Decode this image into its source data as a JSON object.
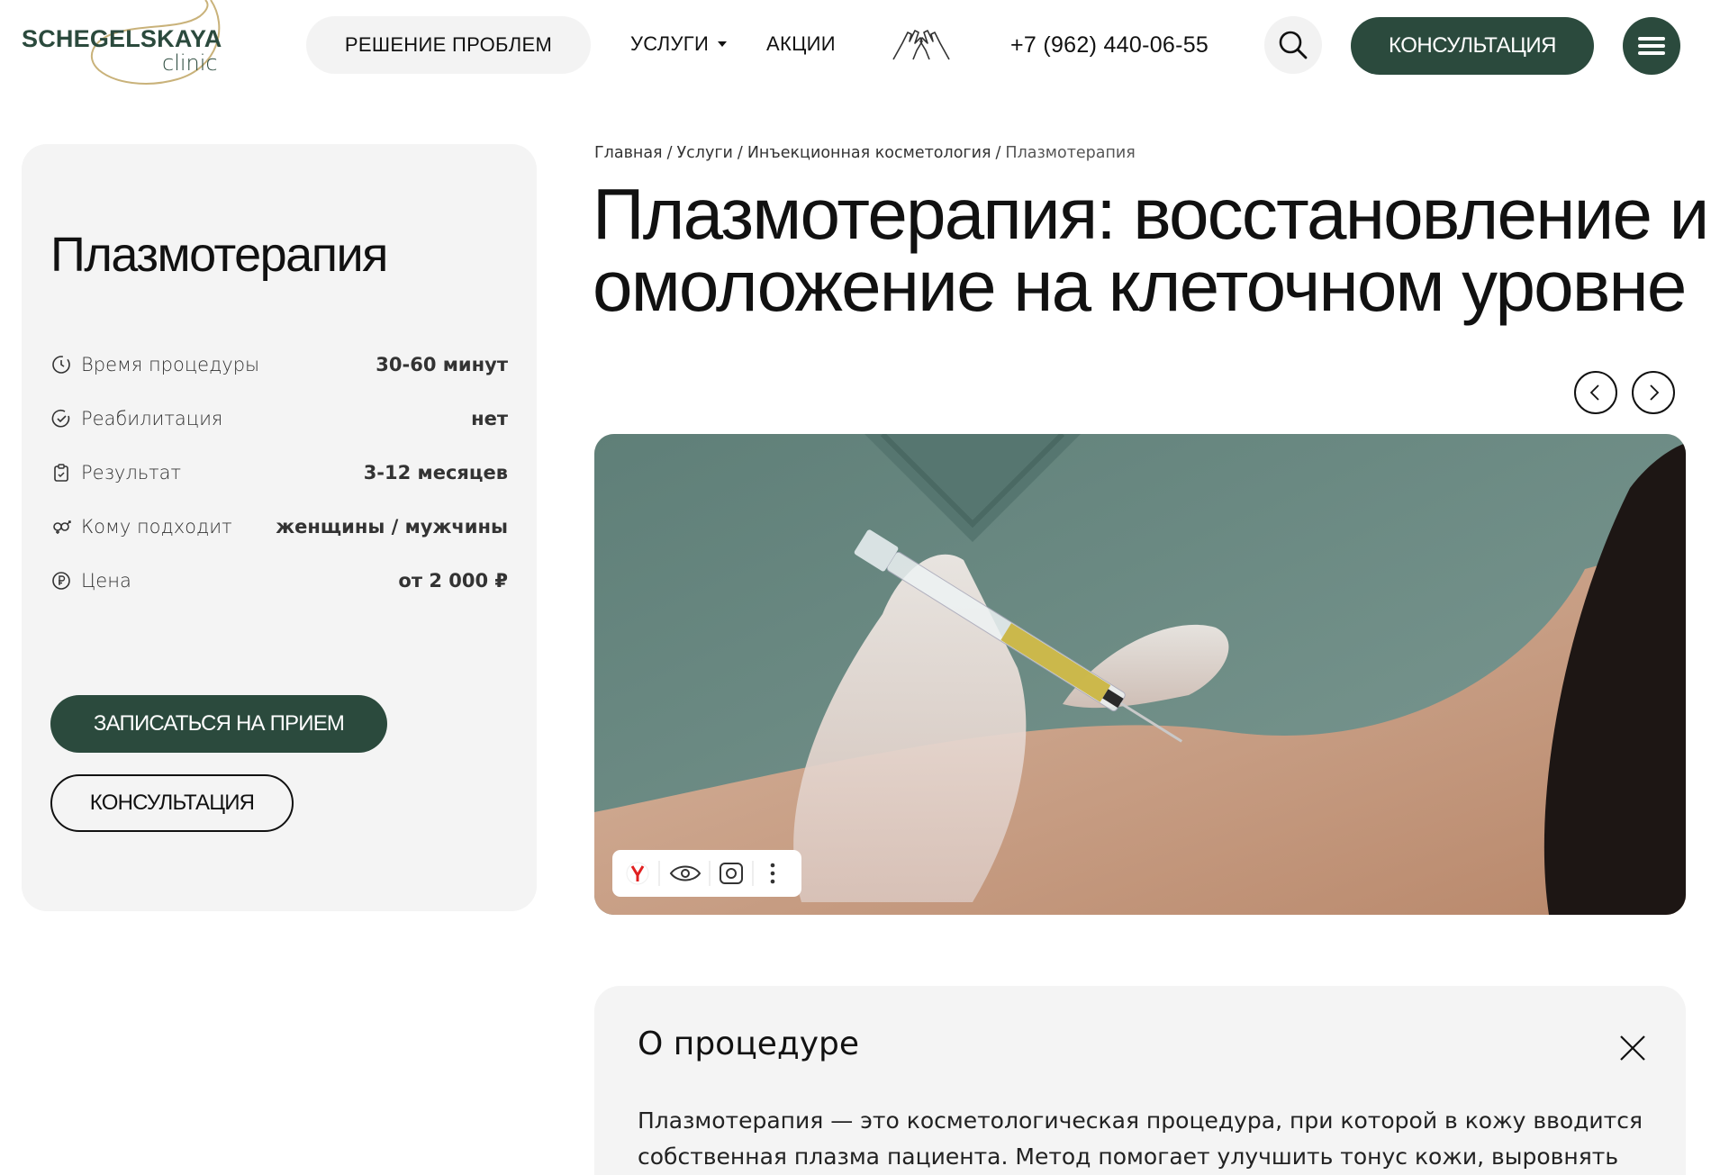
{
  "header": {
    "logo_word": "SCHEGELSKAYA",
    "logo_sub": "clinic",
    "nav_problems": "РЕШЕНИЕ ПРОБЛЕМ",
    "nav_services": "УСЛУГИ",
    "nav_promos": "АКЦИИ",
    "phone": "+7 (962) 440-06-55",
    "consult_label": "КОНСУЛЬТАЦИЯ",
    "icons": [
      "logo-swoosh-icon",
      "caret-down-icon",
      "hands-icon",
      "search-icon",
      "menu-icon"
    ]
  },
  "info_card": {
    "title": "Плазмотерапия",
    "rows": [
      {
        "icon": "clock-icon",
        "label": "Время процедуры",
        "value": "30-60 минут"
      },
      {
        "icon": "check-circle-icon",
        "label": "Реабилитация",
        "value": "нет"
      },
      {
        "icon": "clipboard-icon",
        "label": "Результат",
        "value": "3-12 месяцев"
      },
      {
        "icon": "gender-icon",
        "label": "Кому подходит",
        "value": "женщины / мужчины"
      },
      {
        "icon": "ruble-icon",
        "label": "Цена",
        "value": "от 2 000 ₽"
      }
    ],
    "book_label": "ЗАПИСАТЬСЯ НА ПРИЕМ",
    "consult_label": "КОНСУЛЬТАЦИЯ"
  },
  "breadcrumb": {
    "items": [
      "Главная",
      "Услуги",
      "Инъекционная косметология",
      "Плазмотерапия"
    ],
    "separator": "/"
  },
  "main": {
    "title": "Плазмотерапия: восстановление и омоложение на клеточном уровне",
    "image_toolbar_icons": [
      "yandex-icon",
      "eye-icon",
      "lens-icon",
      "more-icon"
    ]
  },
  "about": {
    "title": "О процедуре",
    "text": "Плазмотерапия — это косметологическая процедура, при которой в кожу вводится собственная плазма пациента. Метод помогает улучшить тонус кожи, выровнять рельеф и запустить процессы омоложения. В обиходе процедуру часто называют"
  },
  "colors": {
    "brand_green": "#2b4a3d",
    "card_bg": "#f4f4f4",
    "logo_gold": "#c9b27a"
  }
}
